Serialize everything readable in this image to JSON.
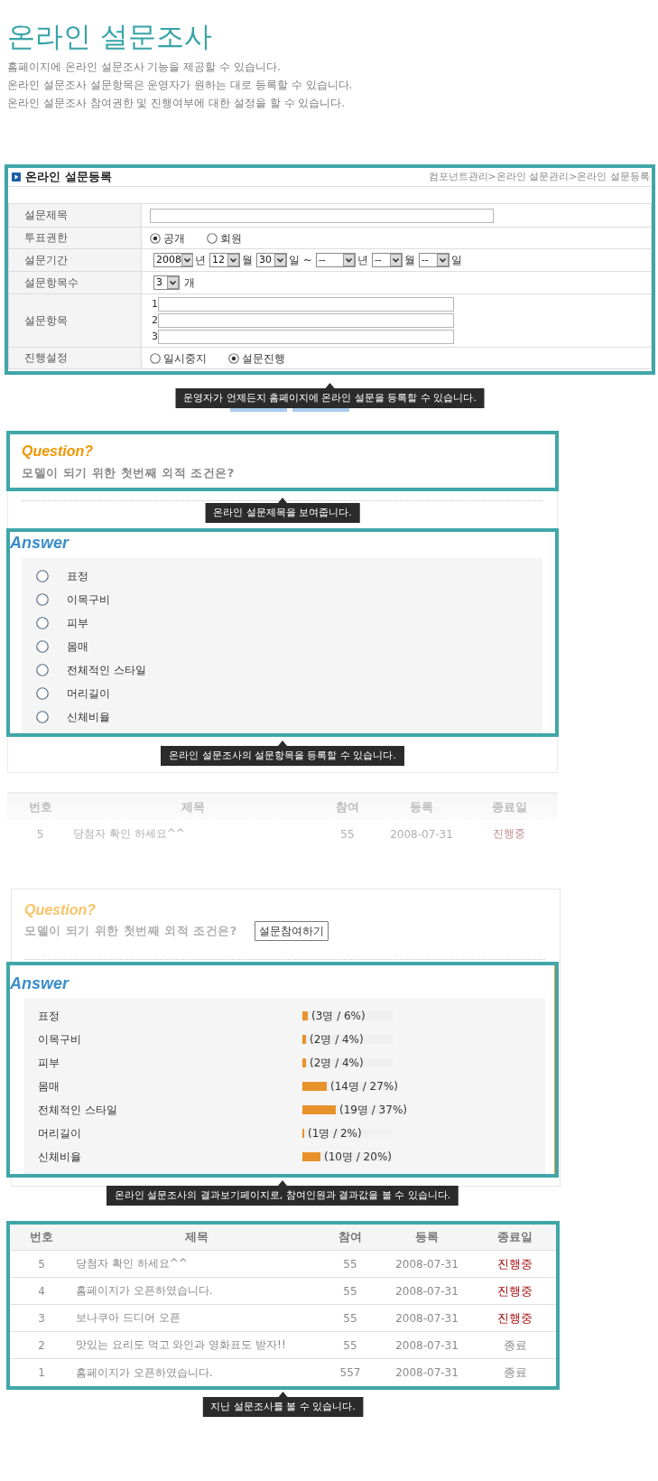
{
  "page_header": {
    "title": "온라인 설문조사",
    "description": [
      "홈페이지에 온라인 설문조사 기능을 제공할 수 있습니다.",
      "온라인 설문조사 설문항목은 운영자가 원하는 대로 등록할 수 있습니다.",
      "온라인 설문조사 참여권한 및 진행여부에 대한 설정을 할 수 있습니다."
    ]
  },
  "registration_form": {
    "title": "온라인 설문등록",
    "breadcrumb": "컴포넌트관리>온라인 설문관리>온라인 설문등록",
    "fields": [
      {
        "kind": "text",
        "label": "설문제목"
      },
      {
        "kind": "radio",
        "label": "투표권한",
        "options": [
          {
            "label": "공개",
            "selected": true
          },
          {
            "label": "회원",
            "selected": false
          }
        ]
      },
      {
        "kind": "period",
        "label": "설문기간",
        "parts": [
          {
            "kind": "year",
            "value": "2008",
            "unit": "년"
          },
          {
            "kind": "month",
            "value": "12",
            "unit": "월"
          },
          {
            "kind": "day",
            "value": "30",
            "unit": "일 ~"
          },
          {
            "kind": "year",
            "value": "--",
            "unit": "년"
          },
          {
            "kind": "month",
            "value": "--",
            "unit": "월"
          },
          {
            "kind": "day",
            "value": "--",
            "unit": "일"
          }
        ]
      },
      {
        "kind": "count",
        "label": "설문항목수",
        "value": "3",
        "unit": "개"
      },
      {
        "kind": "items",
        "label": "설문항목",
        "numbers": [
          "1",
          "2",
          "3"
        ]
      },
      {
        "kind": "radio",
        "label": "진행설정",
        "options": [
          {
            "label": "일시중지",
            "selected": false
          },
          {
            "label": "설문진행",
            "selected": true
          }
        ]
      }
    ],
    "tooltip": "운영자가 언제든지 홈페이지에 온라인 설문을 등록할 수 있습니다."
  },
  "survey_preview": {
    "question": {
      "heading": "Question?",
      "text": "모델이 되기 위한 첫번째 외적 조건은?",
      "tooltip": "온라인 설문제목을 보여줍니다."
    },
    "answer": {
      "heading": "Answer",
      "options": [
        {
          "label": "표정",
          "selected": false
        },
        {
          "label": "이목구비",
          "selected": false
        },
        {
          "label": "피부",
          "selected": false
        },
        {
          "label": "몸매",
          "selected": false
        },
        {
          "label": "전체적인 스타일",
          "selected": false
        },
        {
          "label": "머리길이",
          "selected": false
        },
        {
          "label": "신체비율",
          "selected": false
        }
      ],
      "tooltip": "온라인 설문조사의 설문항목을 등록할 수 있습니다."
    }
  },
  "faded_list": {
    "columns": [
      "번호",
      "제목",
      "참여",
      "등록",
      "종료일"
    ],
    "rows": [
      {
        "number": "5",
        "title": "당첨자 확인 하세요^^",
        "participants": "55",
        "registered": "2008-07-31",
        "status": "진행중",
        "kind": "ongoing"
      }
    ]
  },
  "survey_result": {
    "question": {
      "heading": "Question?",
      "text": "모델이 되기 위한 첫번째 외적 조건은?",
      "button": "설문참여하기"
    },
    "answer": {
      "heading": "Answer",
      "results": [
        {
          "label": "표정",
          "level": 0.06,
          "reading": "(3명 / 6%)"
        },
        {
          "label": "이목구비",
          "level": 0.04,
          "reading": "(2명 / 4%)"
        },
        {
          "label": "피부",
          "level": 0.04,
          "reading": "(2명 / 4%)"
        },
        {
          "label": "몸매",
          "level": 0.27,
          "reading": "(14명 / 27%)"
        },
        {
          "label": "전체적인 스타일",
          "level": 0.37,
          "reading": "(19명 / 37%)"
        },
        {
          "label": "머리길이",
          "level": 0.02,
          "reading": "(1명 / 2%)"
        },
        {
          "label": "신체비율",
          "level": 0.2,
          "reading": "(10명 / 20%)"
        }
      ]
    },
    "tooltip": "온라인 설문조사의 결과보기페이지로, 참여인원과 결과값을 볼 수 있습니다."
  },
  "past_surveys": {
    "columns": [
      "번호",
      "제목",
      "참여",
      "등록",
      "종료일"
    ],
    "rows": [
      {
        "number": "5",
        "title": "당첨자 확인 하세요^^",
        "participants": "55",
        "registered": "2008-07-31",
        "status": "진행중",
        "kind": "ongoing"
      },
      {
        "number": "4",
        "title": "홈페이지가 오픈하였습니다.",
        "participants": "55",
        "registered": "2008-07-31",
        "status": "진행중",
        "kind": "ongoing"
      },
      {
        "number": "3",
        "title": "보나쿠아 드디어 오픈",
        "participants": "55",
        "registered": "2008-07-31",
        "status": "진행중",
        "kind": "ongoing"
      },
      {
        "number": "2",
        "title": "맛있는 요리도 먹고 와인과 영화표도 받자!!",
        "participants": "55",
        "registered": "2008-07-31",
        "status": "종료",
        "kind": "ended"
      },
      {
        "number": "1",
        "title": "홈페이지가 오픈하였습니다.",
        "participants": "557",
        "registered": "2008-07-31",
        "status": "종료",
        "kind": "ended"
      }
    ],
    "tooltip": "지난 설문조사를 볼 수 있습니다."
  }
}
